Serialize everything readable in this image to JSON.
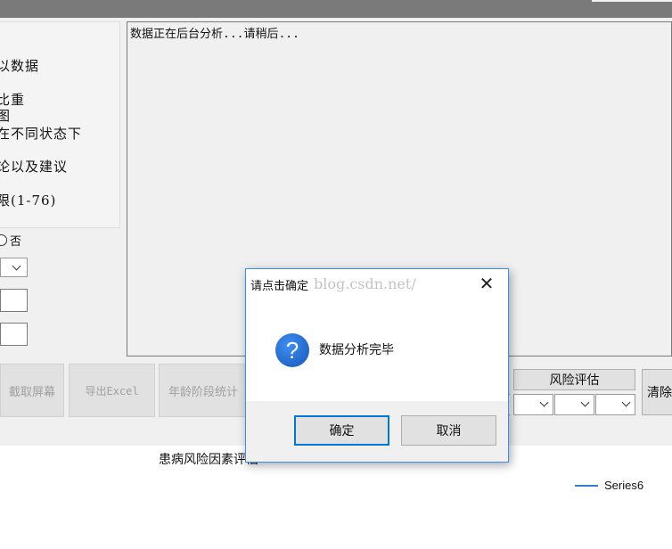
{
  "left_options": [
    "以数据",
    "比重",
    "图",
    "在不同状态下",
    "论以及建议",
    "限(1-76)"
  ],
  "radio": {
    "label": "否"
  },
  "output": {
    "text": "数据正在后台分析...请稍后..."
  },
  "buttons": {
    "screenshot": "截取屏幕",
    "export_excel": "导出Excel",
    "age_stats": "年龄阶段统计",
    "risk_eval": "风险评估",
    "clear": "清除"
  },
  "chart": {
    "title": "患病风险因素评估",
    "legend": "Series6",
    "legend_color": "#2f7fd8"
  },
  "watermark": "blog.csdn.net/",
  "dialog": {
    "title": "请点击确定",
    "icon": "question-icon",
    "message": "数据分析完毕",
    "ok_label": "确定",
    "cancel_label": "取消",
    "accent_color": "#0078d7"
  }
}
